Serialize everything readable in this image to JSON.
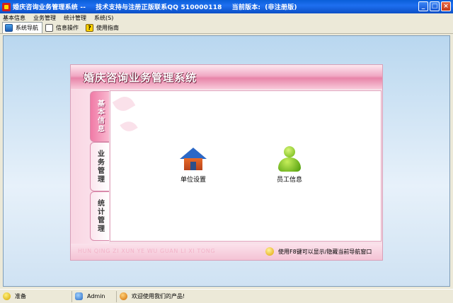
{
  "window": {
    "title": "婚庆咨询业务管理系统 --",
    "support": "技术支持与注册正版联系QQ 510000118",
    "version_label": "当前版本:",
    "version_value": "(非注册版)"
  },
  "menu": [
    "基本信息",
    "业务管理",
    "统计管理",
    "系统(S)"
  ],
  "tabs": [
    {
      "label": "系统导航",
      "icon": "nav-icon",
      "active": true
    },
    {
      "label": "信息操作",
      "icon": "info-icon",
      "active": false
    },
    {
      "label": "使用指南",
      "icon": "help-icon",
      "active": false
    }
  ],
  "panel": {
    "title": "婚庆咨询业务管理系统",
    "side_tabs": [
      "基本信息",
      "业务管理",
      "统计管理"
    ],
    "launchers": [
      {
        "label": "单位设置",
        "icon": "house-icon"
      },
      {
        "label": "员工信息",
        "icon": "person-icon"
      }
    ],
    "footer_pinyin": "HUN QING ZI XUN YE WU GUAN LI XI TONG",
    "footer_hint": "使用F8键可以显示/隐藏当前导航窗口"
  },
  "status": {
    "ready": "准备",
    "user": "Admin",
    "welcome": "欢迎使用我们的产品!"
  }
}
